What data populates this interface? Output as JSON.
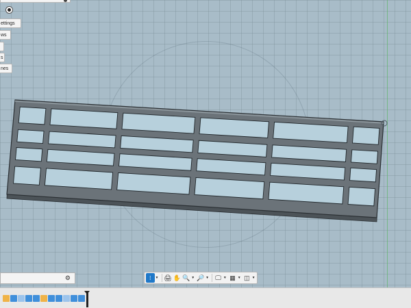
{
  "browser": {
    "rows": [
      {
        "label": "ettings"
      },
      {
        "label": "ws"
      },
      {
        "label": ""
      },
      {
        "label": "s"
      },
      {
        "label": "nes"
      }
    ]
  },
  "toolbar": {
    "buttons": [
      {
        "name": "orbit-tool-icon",
        "glyph": "⁝",
        "active": true
      },
      {
        "name": "save-view-icon",
        "glyph": "🖨"
      },
      {
        "name": "pan-hand-icon",
        "glyph": "✋"
      },
      {
        "name": "zoom-icon",
        "glyph": "🔍"
      },
      {
        "name": "fit-zoom-icon",
        "glyph": "🔎"
      },
      {
        "name": "display-settings-icon",
        "glyph": "🖵"
      },
      {
        "name": "grid-snap-icon",
        "glyph": "▦"
      },
      {
        "name": "viewports-icon",
        "glyph": "◫"
      }
    ]
  },
  "comment_bar": {
    "gear_glyph": "⚙"
  },
  "timeline": {
    "count": 11
  },
  "colors": {
    "viewport": "#a8bcc8",
    "model_body": "#6b7379",
    "model_edge": "#2a2f33",
    "accent": "#1f78c8"
  }
}
